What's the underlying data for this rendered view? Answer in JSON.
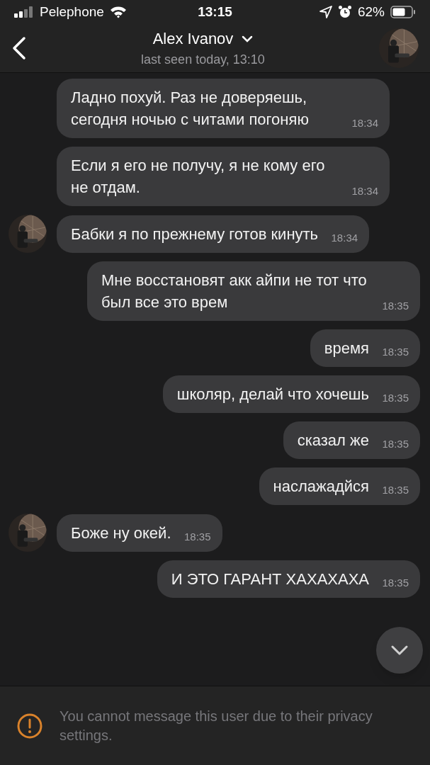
{
  "status_bar": {
    "carrier": "Pelephone",
    "time": "13:15",
    "battery": "62%"
  },
  "header": {
    "name": "Alex Ivanov",
    "status": "last seen today, 13:10"
  },
  "messages": [
    {
      "kind": "incoming",
      "text": "Ладно похуй. Раз не доверяешь, сегодня ночью с читами погоняю",
      "time": "18:34",
      "avatar": false
    },
    {
      "kind": "incoming",
      "text": "Если я его не получу, я не кому его не отдам.",
      "time": "18:34",
      "avatar": false
    },
    {
      "kind": "incoming",
      "text": "Бабки я по прежнему готов кинуть",
      "time": "18:34",
      "avatar": true
    },
    {
      "kind": "outgoing",
      "text": "Мне восстановят акк айпи не тот что был все это врем",
      "time": "18:35",
      "avatar": false
    },
    {
      "kind": "outgoing",
      "text": "время",
      "time": "18:35",
      "avatar": false
    },
    {
      "kind": "outgoing",
      "text": "школяр, делай что хочешь",
      "time": "18:35",
      "avatar": false
    },
    {
      "kind": "outgoing",
      "text": "сказал же",
      "time": "18:35",
      "avatar": false
    },
    {
      "kind": "outgoing",
      "text": "наслажадйся",
      "time": "18:35",
      "avatar": false
    },
    {
      "kind": "incoming",
      "text": "Боже ну окей.",
      "time": "18:35",
      "avatar": true
    },
    {
      "kind": "outgoing",
      "text": "И ЭТО ГАРАНТ ХАХАХАХА",
      "time": "18:35",
      "avatar": false
    }
  ],
  "notice": {
    "text": "You cannot message this user due to their privacy settings."
  }
}
